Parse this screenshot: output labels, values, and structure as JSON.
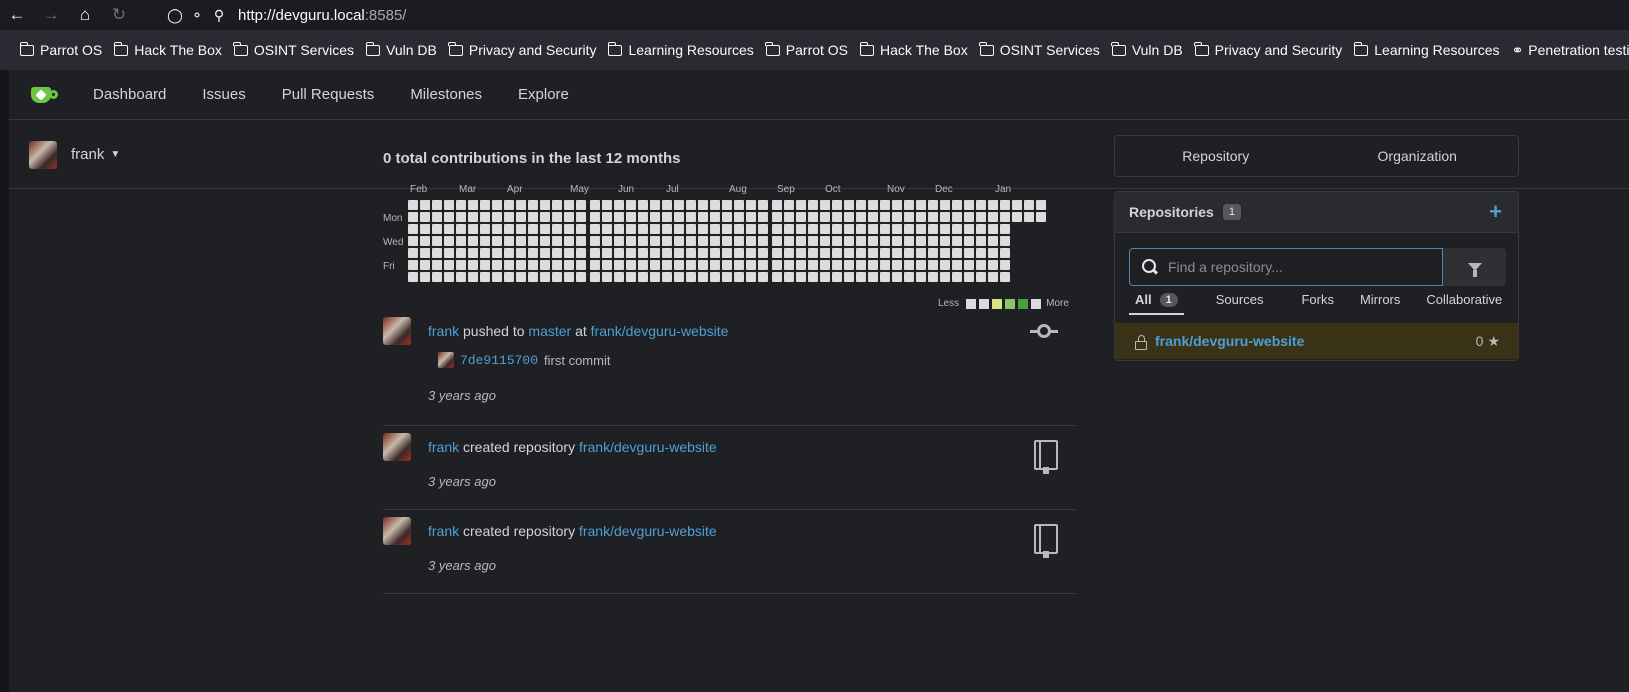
{
  "browser": {
    "url_host": "http://devguru.local",
    "url_port": ":8585/",
    "bookmarks": [
      {
        "label": "Parrot OS",
        "icon": "folder-icon"
      },
      {
        "label": "Hack The Box",
        "icon": "folder-icon"
      },
      {
        "label": "OSINT Services",
        "icon": "folder-icon"
      },
      {
        "label": "Vuln DB",
        "icon": "folder-icon"
      },
      {
        "label": "Privacy and Security",
        "icon": "folder-icon"
      },
      {
        "label": "Learning Resources",
        "icon": "folder-icon"
      },
      {
        "label": "Parrot OS",
        "icon": "folder-icon"
      },
      {
        "label": "Hack The Box",
        "icon": "folder-icon"
      },
      {
        "label": "OSINT Services",
        "icon": "folder-icon"
      },
      {
        "label": "Vuln DB",
        "icon": "folder-icon"
      },
      {
        "label": "Privacy and Security",
        "icon": "folder-icon"
      },
      {
        "label": "Learning Resources",
        "icon": "folder-icon"
      },
      {
        "label": "Penetration testing t",
        "icon": "globe-icon"
      }
    ]
  },
  "nav": {
    "dashboard": "Dashboard",
    "issues": "Issues",
    "pull_requests": "Pull Requests",
    "milestones": "Milestones",
    "explore": "Explore"
  },
  "user": {
    "name": "frank"
  },
  "contributions": {
    "title": "0 total contributions in the last 12 months",
    "months": [
      "Feb",
      "Mar",
      "Apr",
      "May",
      "Jun",
      "Jul",
      "Aug",
      "Sep",
      "Oct",
      "Nov",
      "Dec",
      "Jan"
    ],
    "days": [
      "Mon",
      "Wed",
      "Fri"
    ],
    "legend_less": "Less",
    "legend_more": "More",
    "legend_colors": [
      "#dcdcdc",
      "#dcdcdc",
      "#d6e685",
      "#8cc665",
      "#44a340",
      "#dcdcdc"
    ],
    "cell_color": "#dcdcdc"
  },
  "feed": {
    "push": {
      "user": "frank",
      "action": " pushed to ",
      "branch": "master",
      "at": " at ",
      "repo": "frank/devguru-website",
      "commit_sha": "7de9115700",
      "commit_msg": "first commit",
      "time": "3 years ago"
    },
    "created1": {
      "user": "frank",
      "action": " created repository ",
      "repo": "frank/devguru-website",
      "time": "3 years ago"
    },
    "created2": {
      "user": "frank",
      "action": " created repository ",
      "repo": "frank/devguru-website",
      "time": "3 years ago"
    }
  },
  "sidebar": {
    "tab_repository": "Repository",
    "tab_organization": "Organization",
    "repos_title": "Repositories",
    "repos_count": "1",
    "search_placeholder": "Find a repository...",
    "subtabs": {
      "all": "All",
      "all_count": "1",
      "sources": "Sources",
      "forks": "Forks",
      "mirrors": "Mirrors",
      "collaborative": "Collaborative"
    },
    "repo": {
      "name": "frank/devguru-website",
      "stars": "0"
    }
  }
}
